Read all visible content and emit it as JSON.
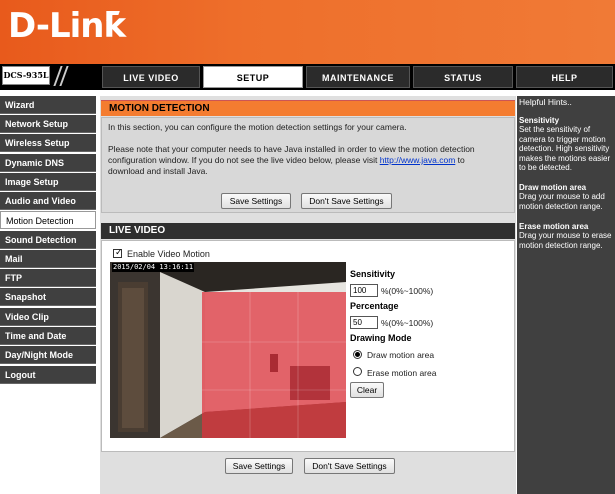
{
  "brand": {
    "name": "D-Link"
  },
  "header": {
    "model": "DCS-935L"
  },
  "tabs": [
    {
      "label": "LIVE VIDEO"
    },
    {
      "label": "SETUP"
    },
    {
      "label": "MAINTENANCE"
    },
    {
      "label": "STATUS"
    },
    {
      "label": "HELP"
    }
  ],
  "sidebar": {
    "items": [
      {
        "label": "Wizard"
      },
      {
        "label": "Network Setup"
      },
      {
        "label": "Wireless Setup"
      },
      {
        "label": "Dynamic DNS"
      },
      {
        "label": "Image Setup"
      },
      {
        "label": "Audio and Video"
      },
      {
        "label": "Motion Detection"
      },
      {
        "label": "Sound Detection"
      },
      {
        "label": "Mail"
      },
      {
        "label": "FTP"
      },
      {
        "label": "Snapshot"
      },
      {
        "label": "Video Clip"
      },
      {
        "label": "Time and Date"
      },
      {
        "label": "Day/Night Mode"
      },
      {
        "label": "Logout"
      }
    ],
    "active_index": 6
  },
  "motion_detection": {
    "title": "MOTION DETECTION",
    "intro": "In this section, you can configure the motion detection settings for your camera.",
    "note_line1": "Please note that your computer needs to have Java installed in order to view the motion detection",
    "note_line2_pre": "configuration window. If you do not see the live video below, please visit ",
    "java_link": "http://www.java.com",
    "note_line2_post": " to",
    "note_line3": "download and install Java.",
    "save_label": "Save Settings",
    "dont_save_label": "Don't Save Settings"
  },
  "live_video": {
    "title": "LIVE VIDEO",
    "enable_label": "Enable Video Motion",
    "enable_checked": true,
    "timestamp": "2015/02/04 13:16:11",
    "sensitivity_label": "Sensitivity",
    "sensitivity_value": "100",
    "sensitivity_range": "%(0%~100%)",
    "percentage_label": "Percentage",
    "percentage_value": "50",
    "percentage_range": "%(0%~100%)",
    "drawing_mode_label": "Drawing Mode",
    "draw_label": "Draw motion area",
    "erase_label": "Erase motion area",
    "draw_selected": true,
    "clear_label": "Clear"
  },
  "footer": {
    "save_label": "Save Settings",
    "dont_save_label": "Don't Save Settings"
  },
  "hints": {
    "title": "Helpful Hints..",
    "sensitivity_title": "Sensitivity",
    "sensitivity_text": "Set the sensitivity of camera to trigger motion detection. High sensitivity makes the motions easier to be detected.",
    "draw_title": "Draw motion area",
    "draw_text": "Drag your mouse to add motion detection range.",
    "erase_title": "Erase motion area",
    "erase_text": "Drag your mouse to erase motion detection range."
  },
  "colors": {
    "header_orange": "#ee6f2b",
    "section_orange": "#f47c30",
    "motion_overlay": "#e0303c",
    "nav_dark": "#404040"
  }
}
